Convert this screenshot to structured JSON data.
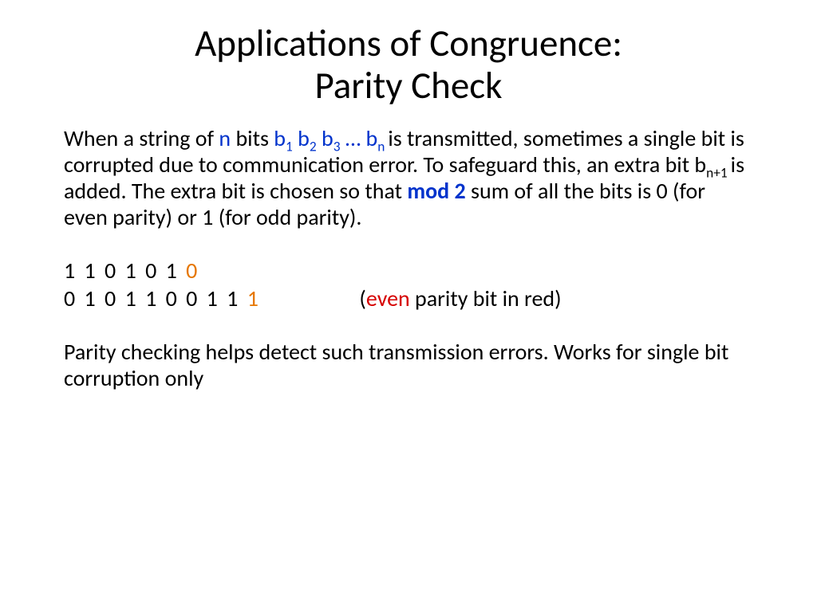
{
  "title_l1": "Applications of Congruence:",
  "title_l2": "Parity Check",
  "p1": {
    "t1": "When a string of ",
    "n": "n",
    "t2": " bits  ",
    "b": "b",
    "s1": "1",
    "sp": " ",
    "s2": "2",
    "s3": "3",
    "ell": " … ",
    "sn": "n ",
    "t3": "is transmitted, sometimes a single bit is corrupted due to communication error. To safeguard this, an extra bit b",
    "sn1": "n+1 ",
    "t4": "is added.  The extra bit is chosen so that ",
    "mod": "mod 2",
    "t5": " sum of all the bits is 0 (for even parity) or 1 (for odd parity)."
  },
  "bits1": {
    "seq": "1  1  0  1  0  1  ",
    "pbit": "0"
  },
  "bits2": {
    "seq": "0  1  0  1  1  0  0  1  1  ",
    "pbit": "1",
    "note_open": "(",
    "note_colored": "even",
    "note_rest": " parity bit in red)"
  },
  "p2": "Parity checking helps detect such transmission errors. Works for single bit corruption only"
}
